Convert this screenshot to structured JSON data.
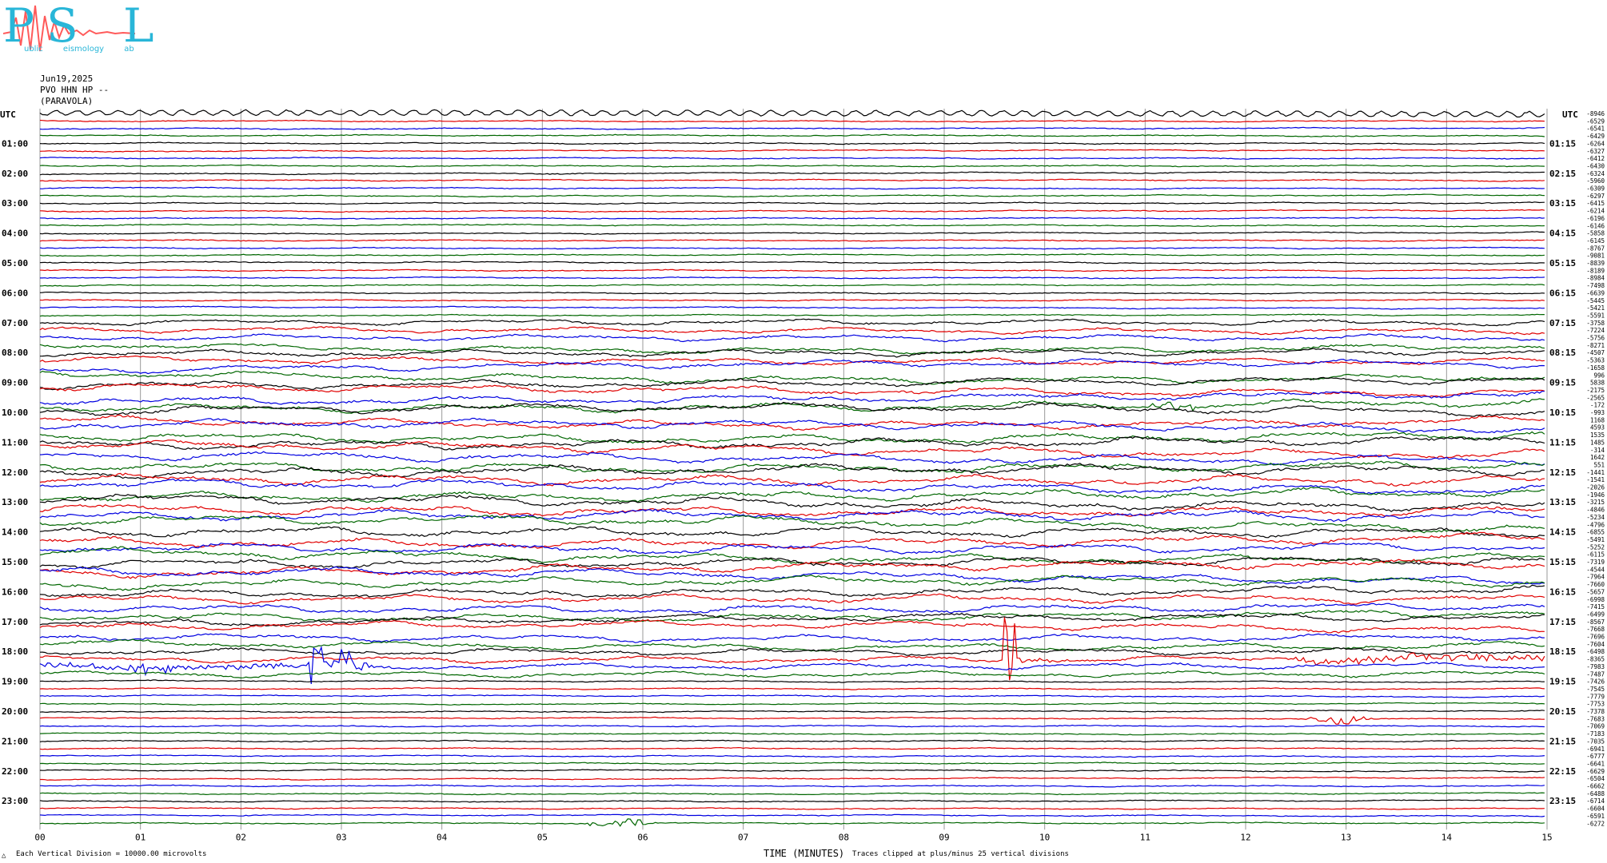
{
  "logo": {
    "letters": [
      "P",
      "S",
      "L"
    ],
    "caption": "ublic eismology ab",
    "colors": {
      "letters": "#29b6d8",
      "wave": "#ff5a5a"
    }
  },
  "header": {
    "date": "Jun19,2025",
    "station": "PVO HHN HP --",
    "place": "(PARAVOLA)",
    "utc_left": "UTC",
    "utc_right": "UTC"
  },
  "footer": {
    "scale_note": "Each Vertical Division = 10000.00 microvolts",
    "x_title": "TIME (MINUTES)",
    "clip_note": "Traces clipped at plus/minus 25 vertical divisions",
    "corner_mark": "△"
  },
  "chart_data": {
    "type": "line",
    "title": "",
    "xlabel": "TIME (MINUTES)",
    "ylabel": "",
    "xlim": [
      0,
      15
    ],
    "x_ticks": [
      "00",
      "01",
      "02",
      "03",
      "04",
      "05",
      "06",
      "07",
      "08",
      "09",
      "10",
      "11",
      "12",
      "13",
      "14",
      "15"
    ],
    "left_hour_labels": [
      "01:00",
      "02:00",
      "03:00",
      "04:00",
      "05:00",
      "06:00",
      "07:00",
      "08:00",
      "09:00",
      "10:00",
      "11:00",
      "12:00",
      "13:00",
      "14:00",
      "15:00",
      "16:00",
      "17:00",
      "18:00",
      "19:00",
      "20:00",
      "21:00",
      "22:00",
      "23:00"
    ],
    "right_hour_labels": [
      "01:15",
      "02:15",
      "03:15",
      "04:15",
      "05:15",
      "06:15",
      "07:15",
      "08:15",
      "09:15",
      "10:15",
      "11:15",
      "12:15",
      "13:15",
      "14:15",
      "15:15",
      "16:15",
      "17:15",
      "18:15",
      "19:15",
      "20:15",
      "21:15",
      "22:15",
      "23:15"
    ],
    "trace_colors": [
      "#000000",
      "#e00000",
      "#0000e0",
      "#006600"
    ],
    "trace_count": 96,
    "trace_offsets": [
      "-8946",
      "-6529",
      "-6541",
      "-6429",
      "-6264",
      "-6327",
      "-6412",
      "-6430",
      "-6324",
      "-5960",
      "-6309",
      "-6297",
      "-6415",
      "-6214",
      "-6196",
      "-6146",
      "-5858",
      "-6145",
      "-8767",
      "-9081",
      "-8839",
      "-8189",
      "-8984",
      "-7498",
      "-6639",
      "-5445",
      "-5421",
      "-5591",
      "-3758",
      "-7224",
      "-5756",
      "-8271",
      "-4507",
      "-5363",
      "-1658",
      "996",
      "5838",
      "-2175",
      "-2565",
      "-172",
      "-993",
      "1168",
      "4593",
      "1535",
      "1485",
      "-314",
      "1642",
      "551",
      "-1441",
      "-1541",
      "-2026",
      "-1946",
      "-3215",
      "-4846",
      "-5234",
      "-4796",
      "-6855",
      "-5491",
      "-5252",
      "-6115",
      "-7319",
      "-4544",
      "-7964",
      "-7660",
      "-5657",
      "-6998",
      "-7415",
      "-6499",
      "-8567",
      "-7668",
      "-7696",
      "-7604",
      "-6498",
      "-8365",
      "-7983",
      "-7487",
      "-7426",
      "-7545",
      "-7779",
      "-7753",
      "-7378",
      "-7683",
      "-7069",
      "-7183",
      "-7035",
      "-6941",
      "-6777",
      "-6641",
      "-6629",
      "-6504",
      "-6662",
      "-6488",
      "-6714",
      "-6604",
      "-6591",
      "-6272"
    ],
    "events": [
      {
        "trace": 73,
        "minute": 9.65,
        "description": "large spike"
      },
      {
        "trace": 73,
        "minute": 12.5,
        "description": "onset of noise burst"
      },
      {
        "trace": 74,
        "minute": 1.1,
        "description": "burst"
      },
      {
        "trace": 74,
        "minute": 2.75,
        "description": "spike"
      },
      {
        "trace": 74,
        "minute": 3.05,
        "description": "spike"
      },
      {
        "trace": 39,
        "minute": 11.3,
        "description": "burst"
      },
      {
        "trace": 95,
        "minute": 5.8,
        "description": "burst"
      },
      {
        "trace": 81,
        "minute": 12.95,
        "description": "burst"
      }
    ]
  }
}
